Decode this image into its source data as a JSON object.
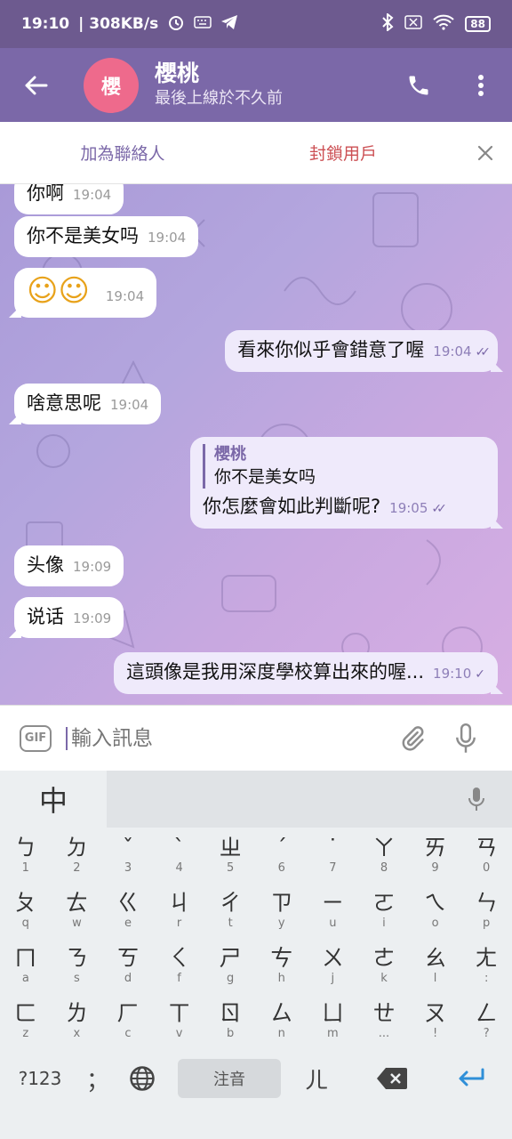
{
  "status": {
    "time": "19:10",
    "speed": "| 308KB/s",
    "battery": "88"
  },
  "header": {
    "avatar_text": "櫻",
    "avatar_color": "#ee6a8c",
    "title": "櫻桃",
    "subtitle": "最後上線於不久前",
    "bar_color": "#7b68a8"
  },
  "action_bar": {
    "add_contact": "加為聯絡人",
    "block_user": "封鎖用戶"
  },
  "messages": [
    {
      "dir": "in",
      "text": "你啊",
      "time": "19:04"
    },
    {
      "dir": "in",
      "text": "你不是美女吗",
      "time": "19:04"
    },
    {
      "dir": "in",
      "text": "☺☺",
      "time": "19:04"
    },
    {
      "dir": "out",
      "text": "看來你似乎會錯意了喔",
      "time": "19:04",
      "read": true
    },
    {
      "dir": "in",
      "text": "啥意思呢",
      "time": "19:04"
    },
    {
      "dir": "out",
      "reply_name": "櫻桃",
      "reply_text": "你不是美女吗",
      "text": "你怎麼會如此判斷呢?",
      "time": "19:05",
      "read": true
    },
    {
      "dir": "in",
      "text": "头像",
      "time": "19:09"
    },
    {
      "dir": "in",
      "text": "说话",
      "time": "19:09"
    },
    {
      "dir": "out",
      "text": "這頭像是我用深度學校算出來的喔...",
      "time": "19:10",
      "read": false
    }
  ],
  "composer": {
    "gif_label": "GIF",
    "placeholder": "輸入訊息"
  },
  "keyboard": {
    "lang_key": "中",
    "rows": [
      [
        [
          "ㄅ",
          "1"
        ],
        [
          "ㄉ",
          "2"
        ],
        [
          "ˇ",
          "3"
        ],
        [
          "ˋ",
          "4"
        ],
        [
          "ㄓ",
          "5"
        ],
        [
          "ˊ",
          "6"
        ],
        [
          "˙",
          "7"
        ],
        [
          "ㄚ",
          "8"
        ],
        [
          "ㄞ",
          "9"
        ],
        [
          "ㄢ",
          "0"
        ]
      ],
      [
        [
          "ㄆ",
          "q"
        ],
        [
          "ㄊ",
          "w"
        ],
        [
          "ㄍ",
          "e"
        ],
        [
          "ㄐ",
          "r"
        ],
        [
          "ㄔ",
          "t"
        ],
        [
          "ㄗ",
          "y"
        ],
        [
          "ㄧ",
          "u"
        ],
        [
          "ㄛ",
          "i"
        ],
        [
          "ㄟ",
          "o"
        ],
        [
          "ㄣ",
          "p"
        ]
      ],
      [
        [
          "ㄇ",
          "a"
        ],
        [
          "ㄋ",
          "s"
        ],
        [
          "ㄎ",
          "d"
        ],
        [
          "ㄑ",
          "f"
        ],
        [
          "ㄕ",
          "g"
        ],
        [
          "ㄘ",
          "h"
        ],
        [
          "ㄨ",
          "j"
        ],
        [
          "ㄜ",
          "k"
        ],
        [
          "ㄠ",
          "l"
        ],
        [
          "ㄤ",
          ":"
        ]
      ],
      [
        [
          "ㄈ",
          "z"
        ],
        [
          "ㄌ",
          "x"
        ],
        [
          "ㄏ",
          "c"
        ],
        [
          "ㄒ",
          "v"
        ],
        [
          "ㄖ",
          "b"
        ],
        [
          "ㄙ",
          "n"
        ],
        [
          "ㄩ",
          "m"
        ],
        [
          "ㄝ",
          "..."
        ],
        [
          "ㄡ",
          "!"
        ],
        [
          "ㄥ",
          "?"
        ]
      ]
    ],
    "symbols_key": "?123",
    "punct_key": "；",
    "space_label": "注音",
    "er_key": "ㄦ"
  }
}
